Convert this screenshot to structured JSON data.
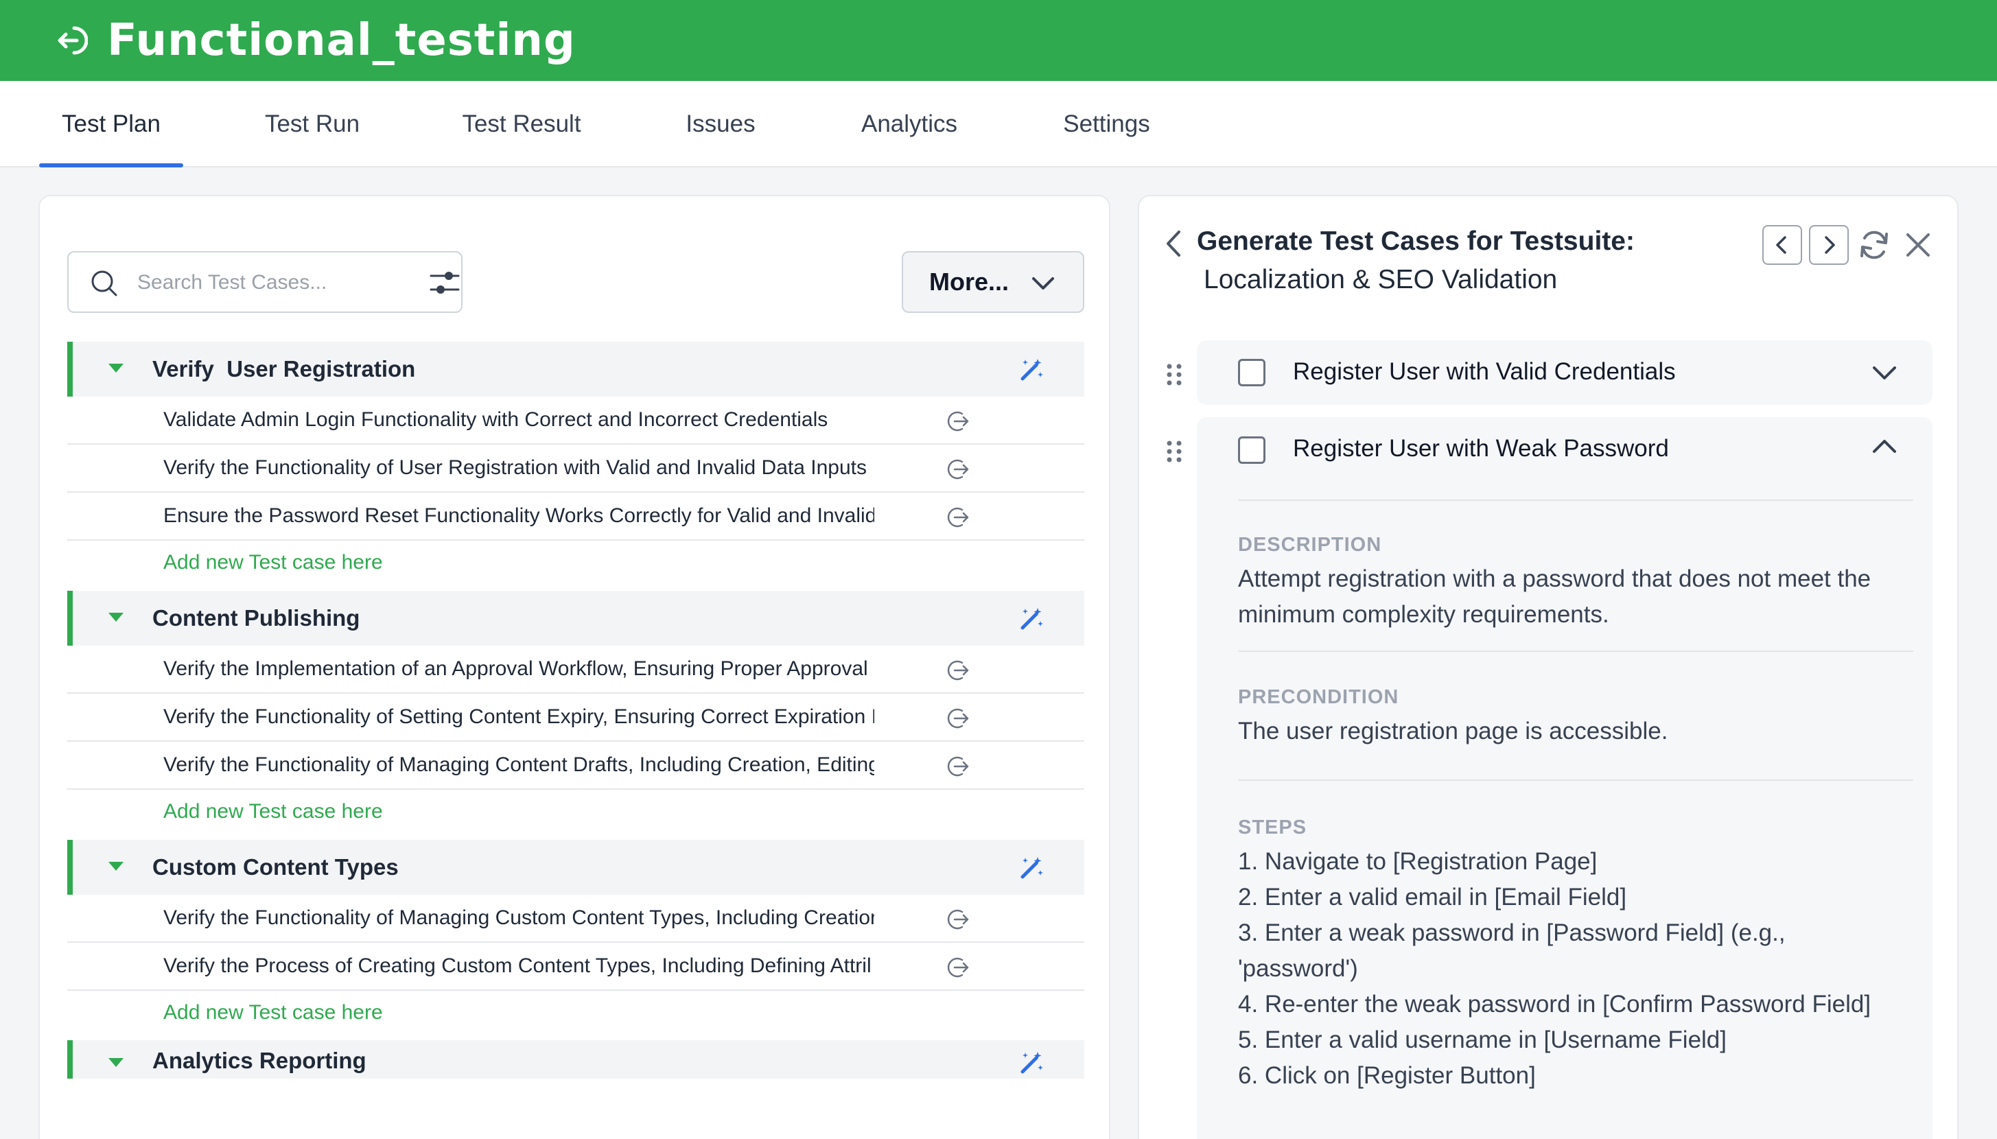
{
  "header": {
    "title": "Functional_testing"
  },
  "tabs": [
    "Test Plan",
    "Test Run",
    "Test Result",
    "Issues",
    "Analytics",
    "Settings"
  ],
  "active_tab": "Test Plan",
  "search": {
    "placeholder": "Search Test Cases..."
  },
  "more_button": {
    "label": "More..."
  },
  "add_link": "Add new Test case here",
  "suites": [
    {
      "title": "Verify  User Registration",
      "cases": [
        "Validate Admin Login Functionality with Correct and Incorrect Credentials",
        "Verify the Functionality of User Registration with Valid and Invalid Data Inputs",
        "Ensure the Password Reset Functionality Works Correctly for Valid and Invalid"
      ]
    },
    {
      "title": "Content Publishing",
      "cases": [
        "Verify the Implementation of an Approval Workflow, Ensuring Proper Approval",
        "Verify the Functionality of Setting Content Expiry, Ensuring Correct Expiration I",
        "Verify the Functionality of Managing Content Drafts, Including Creation, Editing"
      ]
    },
    {
      "title": "Custom Content Types",
      "cases": [
        "Verify the Functionality of Managing Custom Content Types, Including Creation",
        "Verify the Process of Creating Custom Content Types, Including Defining Attril"
      ]
    },
    {
      "title": "Analytics Reporting",
      "cases": []
    }
  ],
  "generator": {
    "title": "Generate Test Cases for Testsuite:",
    "subtitle": "Localization & SEO Validation",
    "cases": [
      {
        "title": "Register User with Valid Credentials",
        "expanded": false
      },
      {
        "title": "Register User with Weak Password",
        "expanded": true,
        "description_label": "DESCRIPTION",
        "description": "Attempt registration with a password that does not meet the minimum complexity requirements.",
        "precondition_label": "PRECONDITION",
        "precondition": "The user registration page is accessible.",
        "steps_label": "STEPS",
        "steps": [
          "1. Navigate to [Registration Page]",
          "2. Enter a valid email in [Email Field]",
          "3. Enter a weak password in [Password Field] (e.g.,",
          "'password')",
          "4. Re-enter the weak password in [Confirm Password Field]",
          "5. Enter a valid username in [Username Field]",
          "6. Click on [Register Button]"
        ]
      }
    ]
  },
  "colors": {
    "brand": "#2faa4f",
    "accent": "#2f6fe4",
    "wand": "#2f6fe4"
  }
}
